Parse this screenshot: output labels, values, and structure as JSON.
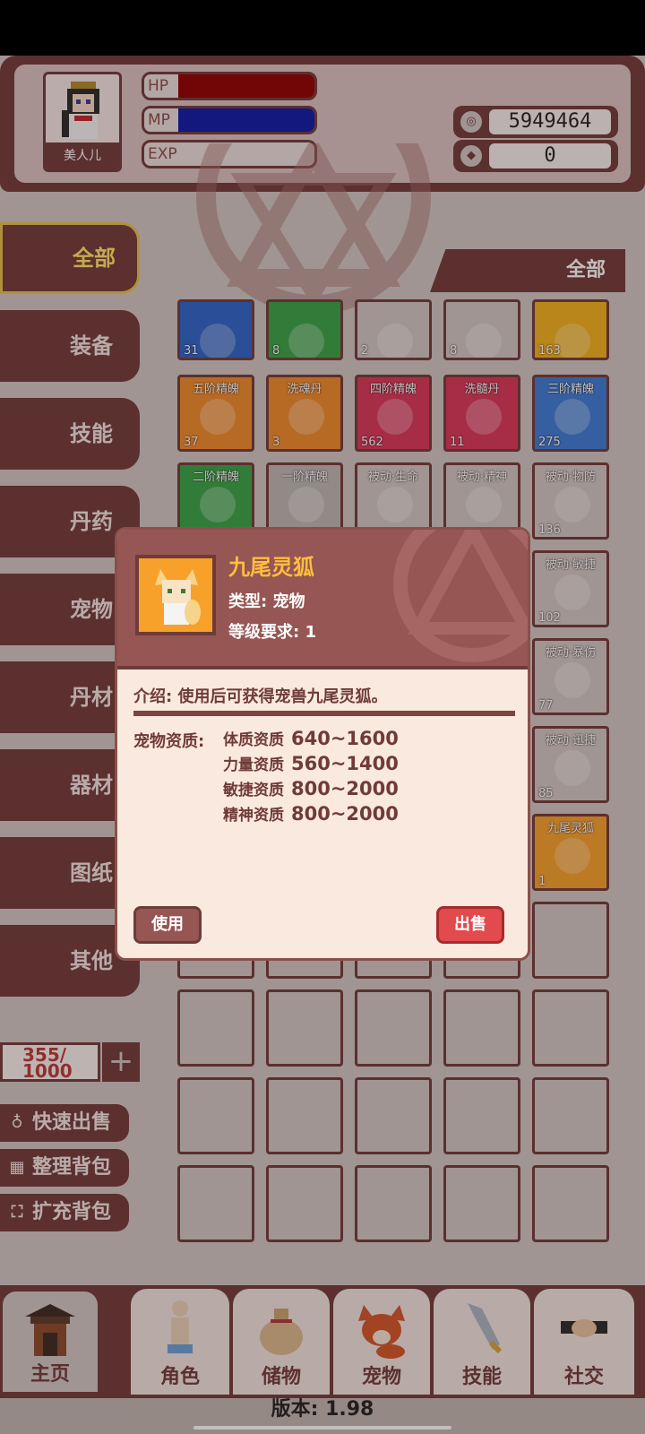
{
  "player": {
    "name": "美人儿",
    "hp_label": "HP",
    "mp_label": "MP",
    "exp_label": "EXP",
    "hp_fraction": 1.0,
    "mp_fraction": 1.0,
    "exp_fraction": 0.0
  },
  "currencies": [
    {
      "icon": "coin-icon",
      "value": "5949464"
    },
    {
      "icon": "gem-icon",
      "value": "0"
    }
  ],
  "category_header": "全部",
  "side_tabs": [
    {
      "label": "全部",
      "active": true
    },
    {
      "label": "装备"
    },
    {
      "label": "技能"
    },
    {
      "label": "丹药"
    },
    {
      "label": "宠物"
    },
    {
      "label": "丹材"
    },
    {
      "label": "器材"
    },
    {
      "label": "图纸"
    },
    {
      "label": "其他"
    }
  ],
  "inventory": {
    "capacity_used": "355/",
    "capacity_total": "1000",
    "plus_label": "+",
    "cells": [
      {
        "name": "",
        "count": "31",
        "color": "#2c64c9"
      },
      {
        "name": "",
        "count": "8",
        "color": "#37a447"
      },
      {
        "name": "",
        "count": "2",
        "color": "#cfc7c2"
      },
      {
        "name": "",
        "count": "8",
        "color": "#cfc7c2"
      },
      {
        "name": "",
        "count": "163",
        "color": "#f0b21d"
      },
      {
        "name": "五阶精魄",
        "count": "37",
        "color": "#ef8b2a"
      },
      {
        "name": "洗魂丹",
        "count": "3",
        "color": "#ef8b2a"
      },
      {
        "name": "四阶精魄",
        "count": "562",
        "color": "#d8365b"
      },
      {
        "name": "洗髓丹",
        "count": "11",
        "color": "#d8365b"
      },
      {
        "name": "三阶精魄",
        "count": "275",
        "color": "#3b7cd6"
      },
      {
        "name": "二阶精魄",
        "count": "",
        "color": "#37a447"
      },
      {
        "name": "一阶精魄",
        "count": "",
        "color": "#bdb8b5"
      },
      {
        "name": "被动·生命",
        "count": "",
        "color": "#cfc7c2"
      },
      {
        "name": "被动·精神",
        "count": "",
        "color": "#cfc7c2"
      },
      {
        "name": "被动·物防",
        "count": "136",
        "color": "#cfc7c2"
      },
      {
        "name": "被动·敏捷",
        "count": "102",
        "color": "#cfc7c2"
      },
      {
        "name": "被动·暴伤",
        "count": "77",
        "color": "#cfc7c2"
      },
      {
        "name": "被动·迅捷",
        "count": "85",
        "color": "#cfc7c2"
      },
      {
        "name": "九尾灵狐",
        "count": "1",
        "color": "#f7a12a"
      }
    ]
  },
  "actions": [
    {
      "icon": "money-bag-icon",
      "label": "快速出售"
    },
    {
      "icon": "grid-icon",
      "label": "整理背包"
    },
    {
      "icon": "expand-icon",
      "label": "扩充背包"
    }
  ],
  "bottom_nav": [
    {
      "label": "主页",
      "icon": "home-gate-icon"
    },
    {
      "label": "角色",
      "icon": "character-icon"
    },
    {
      "label": "储物",
      "icon": "storage-bag-icon"
    },
    {
      "label": "宠物",
      "icon": "pet-fox-icon"
    },
    {
      "label": "技能",
      "icon": "sword-icon"
    },
    {
      "label": "社交",
      "icon": "handshake-icon"
    }
  ],
  "version": "版本: 1.98",
  "modal": {
    "title": "九尾灵狐",
    "type_line": "类型: 宠物",
    "level_line": "等级要求: 1",
    "description": "介绍: 使用后可获得宠兽九尾灵狐。",
    "attr_label": "宠物资质:",
    "attributes": [
      {
        "name": "体质资质",
        "value": "640~1600"
      },
      {
        "name": "力量资质",
        "value": "560~1400"
      },
      {
        "name": "敏捷资质",
        "value": "800~2000"
      },
      {
        "name": "精神资质",
        "value": "800~2000"
      }
    ],
    "use_label": "使用",
    "sell_label": "出售"
  }
}
